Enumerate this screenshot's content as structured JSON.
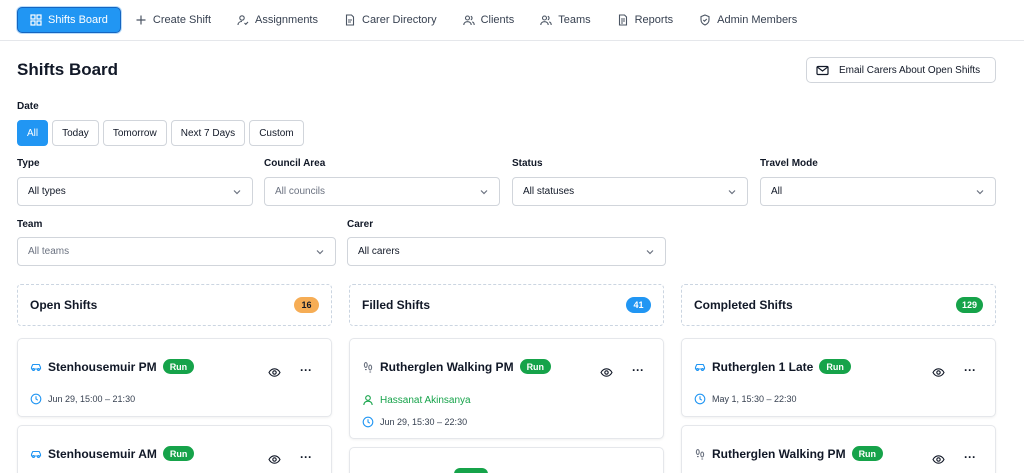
{
  "nav": {
    "items": [
      {
        "label": "Shifts Board",
        "icon": "grid-icon",
        "active": true
      },
      {
        "label": "Create Shift",
        "icon": "plus-icon"
      },
      {
        "label": "Assignments",
        "icon": "user-check-icon"
      },
      {
        "label": "Carer Directory",
        "icon": "document-icon"
      },
      {
        "label": "Clients",
        "icon": "users-icon"
      },
      {
        "label": "Teams",
        "icon": "users-icon"
      },
      {
        "label": "Reports",
        "icon": "report-icon"
      },
      {
        "label": "Admin Members",
        "icon": "shield-icon"
      }
    ]
  },
  "header": {
    "title": "Shifts Board",
    "email_button": "Email Carers About Open Shifts"
  },
  "filters": {
    "date_label": "Date",
    "date_options": [
      "All",
      "Today",
      "Tomorrow",
      "Next 7 Days",
      "Custom"
    ],
    "date_selected": "All",
    "type": {
      "label": "Type",
      "value": "All types"
    },
    "council": {
      "label": "Council Area",
      "placeholder": "All councils"
    },
    "status": {
      "label": "Status",
      "value": "All statuses"
    },
    "travel": {
      "label": "Travel Mode",
      "value": "All"
    },
    "team": {
      "label": "Team",
      "placeholder": "All teams"
    },
    "carer": {
      "label": "Carer",
      "value": "All carers"
    }
  },
  "columns": {
    "open": {
      "title": "Open Shifts",
      "count": "16"
    },
    "filled": {
      "title": "Filled Shifts",
      "count": "41"
    },
    "completed": {
      "title": "Completed Shifts",
      "count": "129"
    }
  },
  "cards": {
    "open": [
      {
        "title": "Stenhousemuir PM",
        "badge": "Run",
        "travel_icon": "car-icon",
        "time": "Jun 29, 15:00 – 21:30"
      },
      {
        "title": "Stenhousemuir AM",
        "badge": "Run",
        "travel_icon": "car-icon"
      }
    ],
    "filled": [
      {
        "title": "Rutherglen Walking PM",
        "badge": "Run",
        "travel_icon": "footprints-icon",
        "carer": "Hassanat Akinsanya",
        "time": "Jun 29, 15:30 – 22:30"
      }
    ],
    "completed": [
      {
        "title": "Rutherglen 1 Late",
        "badge": "Run",
        "travel_icon": "car-icon",
        "time": "May 1, 15:30 – 22:30"
      },
      {
        "title": "Rutherglen Walking PM",
        "badge": "Run",
        "travel_icon": "footprints-icon"
      }
    ]
  },
  "colors": {
    "primary": "#2196f3",
    "success": "#16a34a",
    "open_count_bg": "#f6ad55",
    "filled_count_bg": "#2196f3",
    "completed_count_bg": "#16a34a"
  }
}
